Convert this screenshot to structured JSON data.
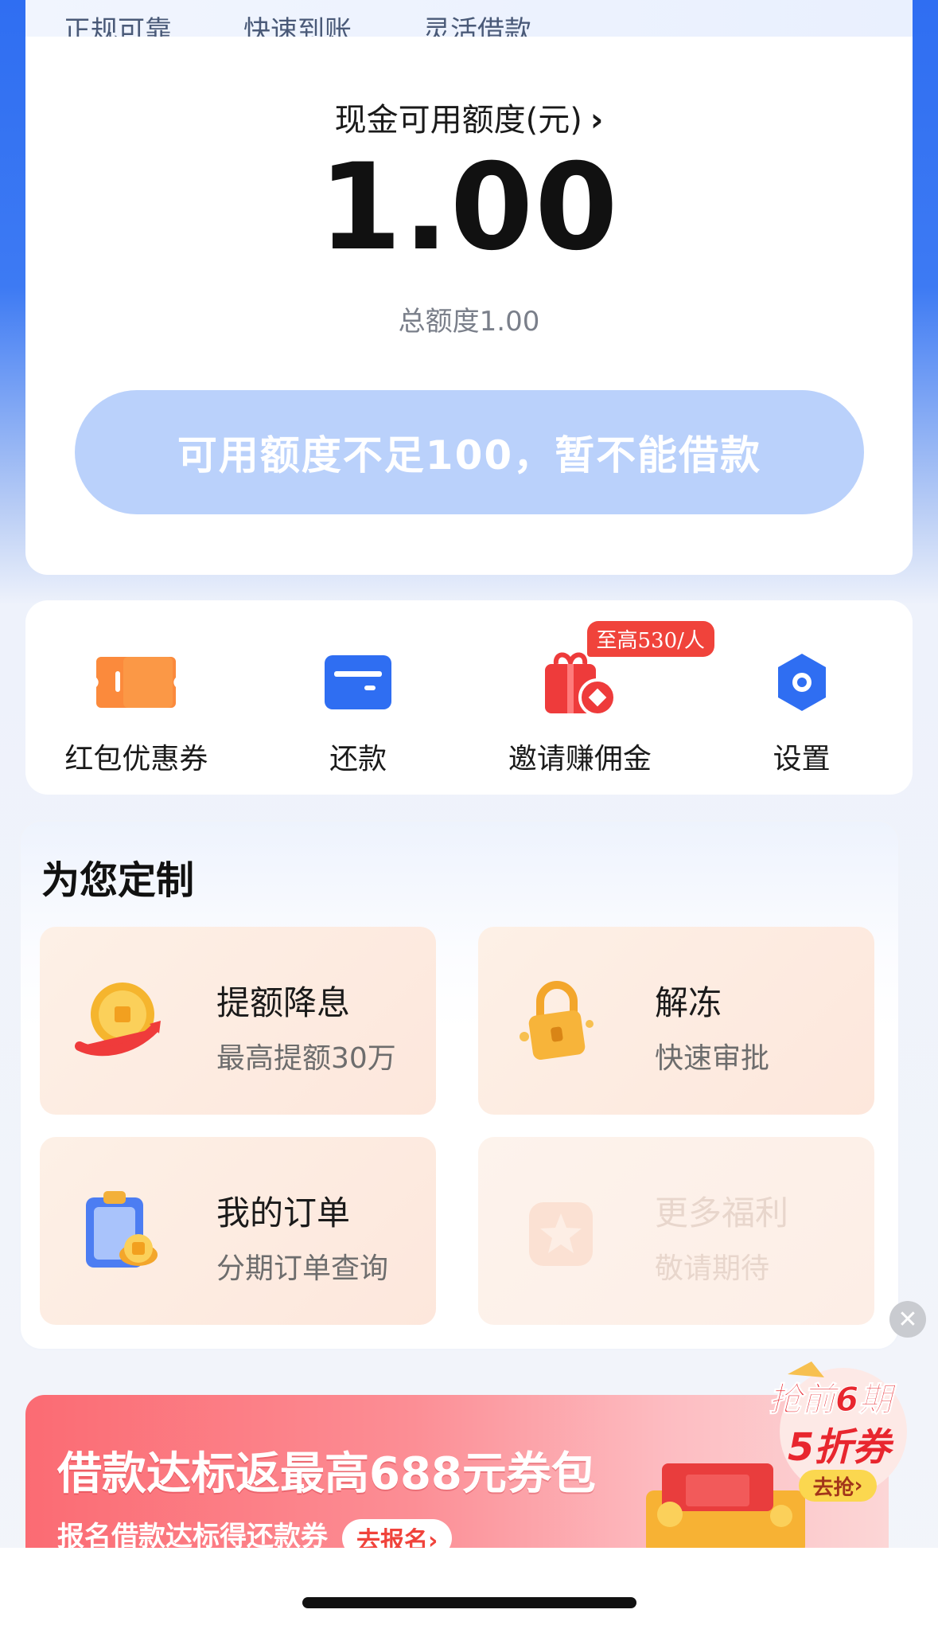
{
  "top_tags": [
    "正规可靠",
    "快速到账",
    "灵活借款"
  ],
  "credit": {
    "title": "现金可用额度(元)",
    "chevron": "›",
    "amount": "1.00",
    "total_label": "总额度1.00",
    "button_label": "可用额度不足100，暂不能借款"
  },
  "actions": [
    {
      "label": "红包优惠券",
      "icon": "coupon-icon"
    },
    {
      "label": "还款",
      "icon": "repay-card-icon"
    },
    {
      "label": "邀请赚佣金",
      "icon": "gift-icon",
      "badge": "至高530/人"
    },
    {
      "label": "设置",
      "icon": "gear-icon"
    }
  ],
  "custom": {
    "title": "为您定制",
    "tiles": [
      {
        "title": "提额降息",
        "sub": "最高提额30万",
        "icon": "coin-arrow-icon"
      },
      {
        "title": "解冻",
        "sub": "快速审批",
        "icon": "lock-icon"
      },
      {
        "title": "我的订单",
        "sub": "分期订单查询",
        "icon": "clipboard-icon"
      },
      {
        "title": "更多福利",
        "sub": "敬请期待",
        "icon": "star-icon"
      }
    ]
  },
  "banner": {
    "title": "借款达标返最高688元券包",
    "sub": "报名借款达标得还款券",
    "cta": "去报名",
    "cta_chevron": "›"
  },
  "float_ad": {
    "line1": "抢前6期",
    "line2": "5折券",
    "cta": "去抢"
  },
  "colors": {
    "brand_blue": "#2f6ef2",
    "button_disabled": "#bad1fb",
    "badge_red": "#f0433b",
    "banner_red": "#fb6b73"
  }
}
